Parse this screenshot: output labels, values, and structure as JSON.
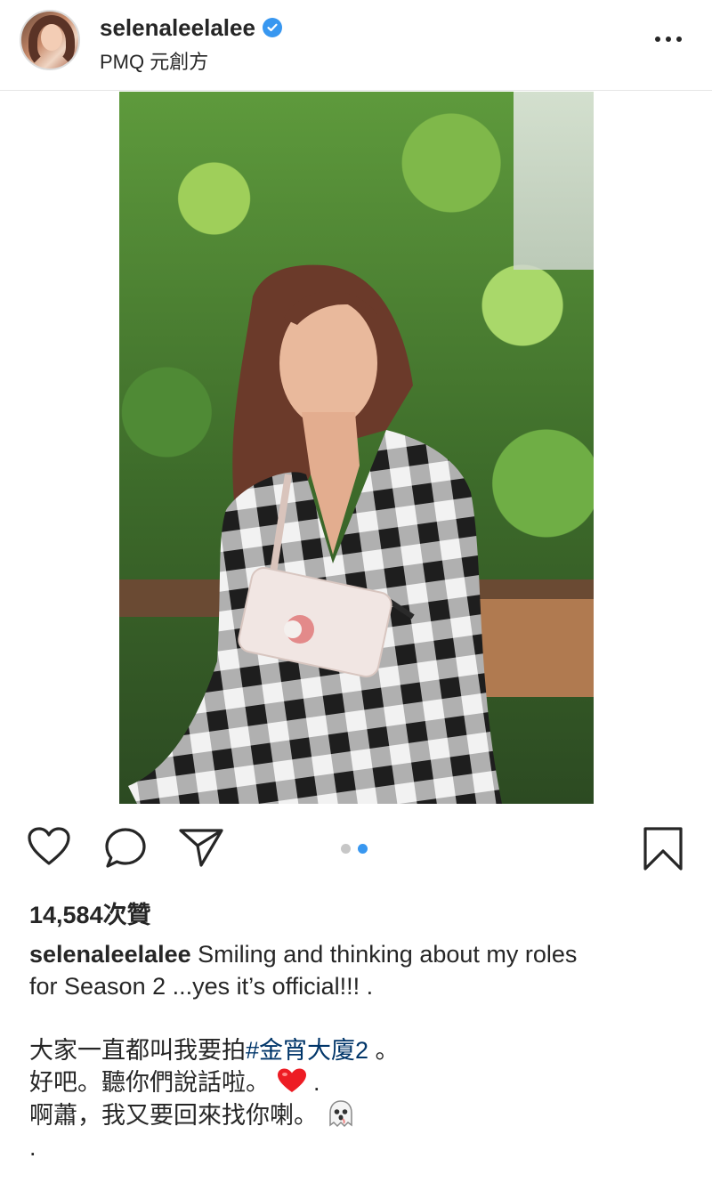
{
  "header": {
    "username": "selenaleelalee",
    "location": "PMQ 元創方",
    "verified_icon": "verified-badge-icon",
    "more_icon": "more-options-icon"
  },
  "post": {
    "image_alt": "photo",
    "carousel": {
      "total": 2,
      "current": 2
    }
  },
  "actions": {
    "like_icon": "heart-icon",
    "comment_icon": "comment-icon",
    "share_icon": "send-icon",
    "save_icon": "bookmark-icon"
  },
  "likes": "14,584次贊",
  "caption": {
    "username": "selenaleelalee",
    "line1_text": "Smiling and thinking about my roles",
    "line2": "for Season 2 ...yes it’s official!!! .",
    "line4_prefix": "大家一直都叫我要拍",
    "line4_hashtag": "#金宵大廈2",
    "line4_suffix": " 。",
    "line5_prefix": "好吧。聽你們說話啦。",
    "line5_suffix": " .",
    "line6_prefix": "啊蕭，我又要回來找你喇。",
    "line7": "."
  },
  "colors": {
    "accent_blue": "#3897f0",
    "text": "#262626",
    "hashtag": "#003569",
    "heart_red": "#ed1c24"
  }
}
